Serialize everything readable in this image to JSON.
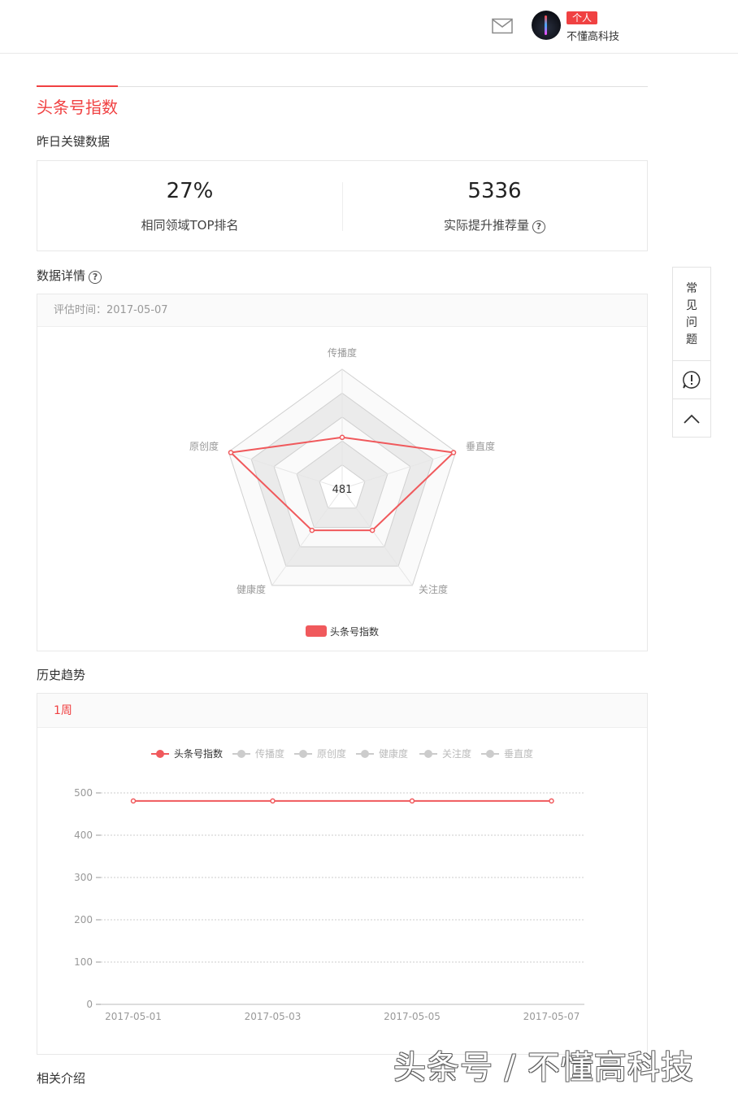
{
  "header": {
    "badge": "个人",
    "user_name": "不懂高科技",
    "icons": {
      "mail": "mail-icon",
      "avatar": "avatar"
    }
  },
  "page_title": "头条号指数",
  "key_data": {
    "title": "昨日关键数据",
    "items": [
      {
        "value": "27%",
        "label": "相同领域TOP排名"
      },
      {
        "value": "5336",
        "label": "实际提升推荐量"
      }
    ]
  },
  "detail": {
    "title": "数据详情",
    "eval_time": "评估时间：2017-05-07",
    "center_value": "481",
    "legend": "头条号指数"
  },
  "history": {
    "title": "历史趋势",
    "tab": "1周"
  },
  "related_title": "相关介绍",
  "side": {
    "faq": "常见问题"
  },
  "watermark": "头条号 / 不懂高科技",
  "colors": {
    "accent": "#f04142",
    "series": "#f0595c",
    "inactive": "#cccccc"
  },
  "chart_data": [
    {
      "type": "radar",
      "indicators": [
        "传播度",
        "垂直度",
        "关注度",
        "健康度",
        "原创度"
      ],
      "series": [
        {
          "name": "头条号指数",
          "values": [
            0.43,
            0.98,
            0.43,
            0.43,
            0.98
          ]
        }
      ],
      "center_label": "481"
    },
    {
      "type": "line",
      "x": [
        "2017-05-01",
        "2017-05-03",
        "2017-05-05",
        "2017-05-07"
      ],
      "series": [
        {
          "name": "头条号指数",
          "values": [
            481,
            481,
            481,
            481
          ],
          "active": true
        },
        {
          "name": "传播度",
          "values": [],
          "active": false
        },
        {
          "name": "原创度",
          "values": [],
          "active": false
        },
        {
          "name": "健康度",
          "values": [],
          "active": false
        },
        {
          "name": "关注度",
          "values": [],
          "active": false
        },
        {
          "name": "垂直度",
          "values": [],
          "active": false
        }
      ],
      "y_ticks": [
        "0",
        "100",
        "200",
        "300",
        "400",
        "500"
      ],
      "ylim": [
        0,
        500
      ],
      "grid": true,
      "legend_position": "top"
    }
  ]
}
